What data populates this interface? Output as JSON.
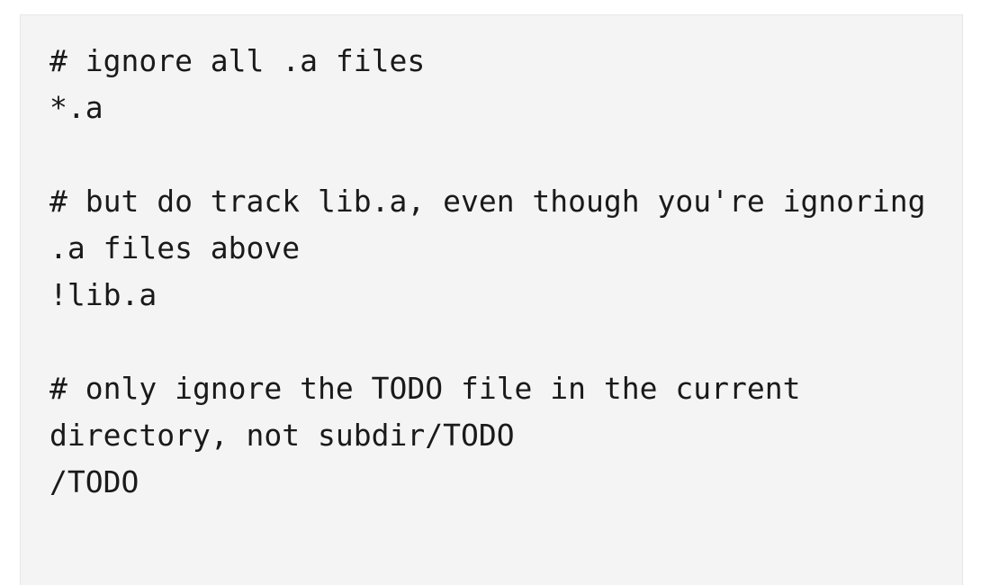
{
  "code_block": {
    "lines": [
      "# ignore all .a files",
      "*.a",
      "",
      "# but do track lib.a, even though you're ignoring",
      ".a files above",
      "!lib.a",
      "",
      "# only ignore the TODO file in the current",
      "directory, not subdir/TODO",
      "/TODO"
    ]
  }
}
